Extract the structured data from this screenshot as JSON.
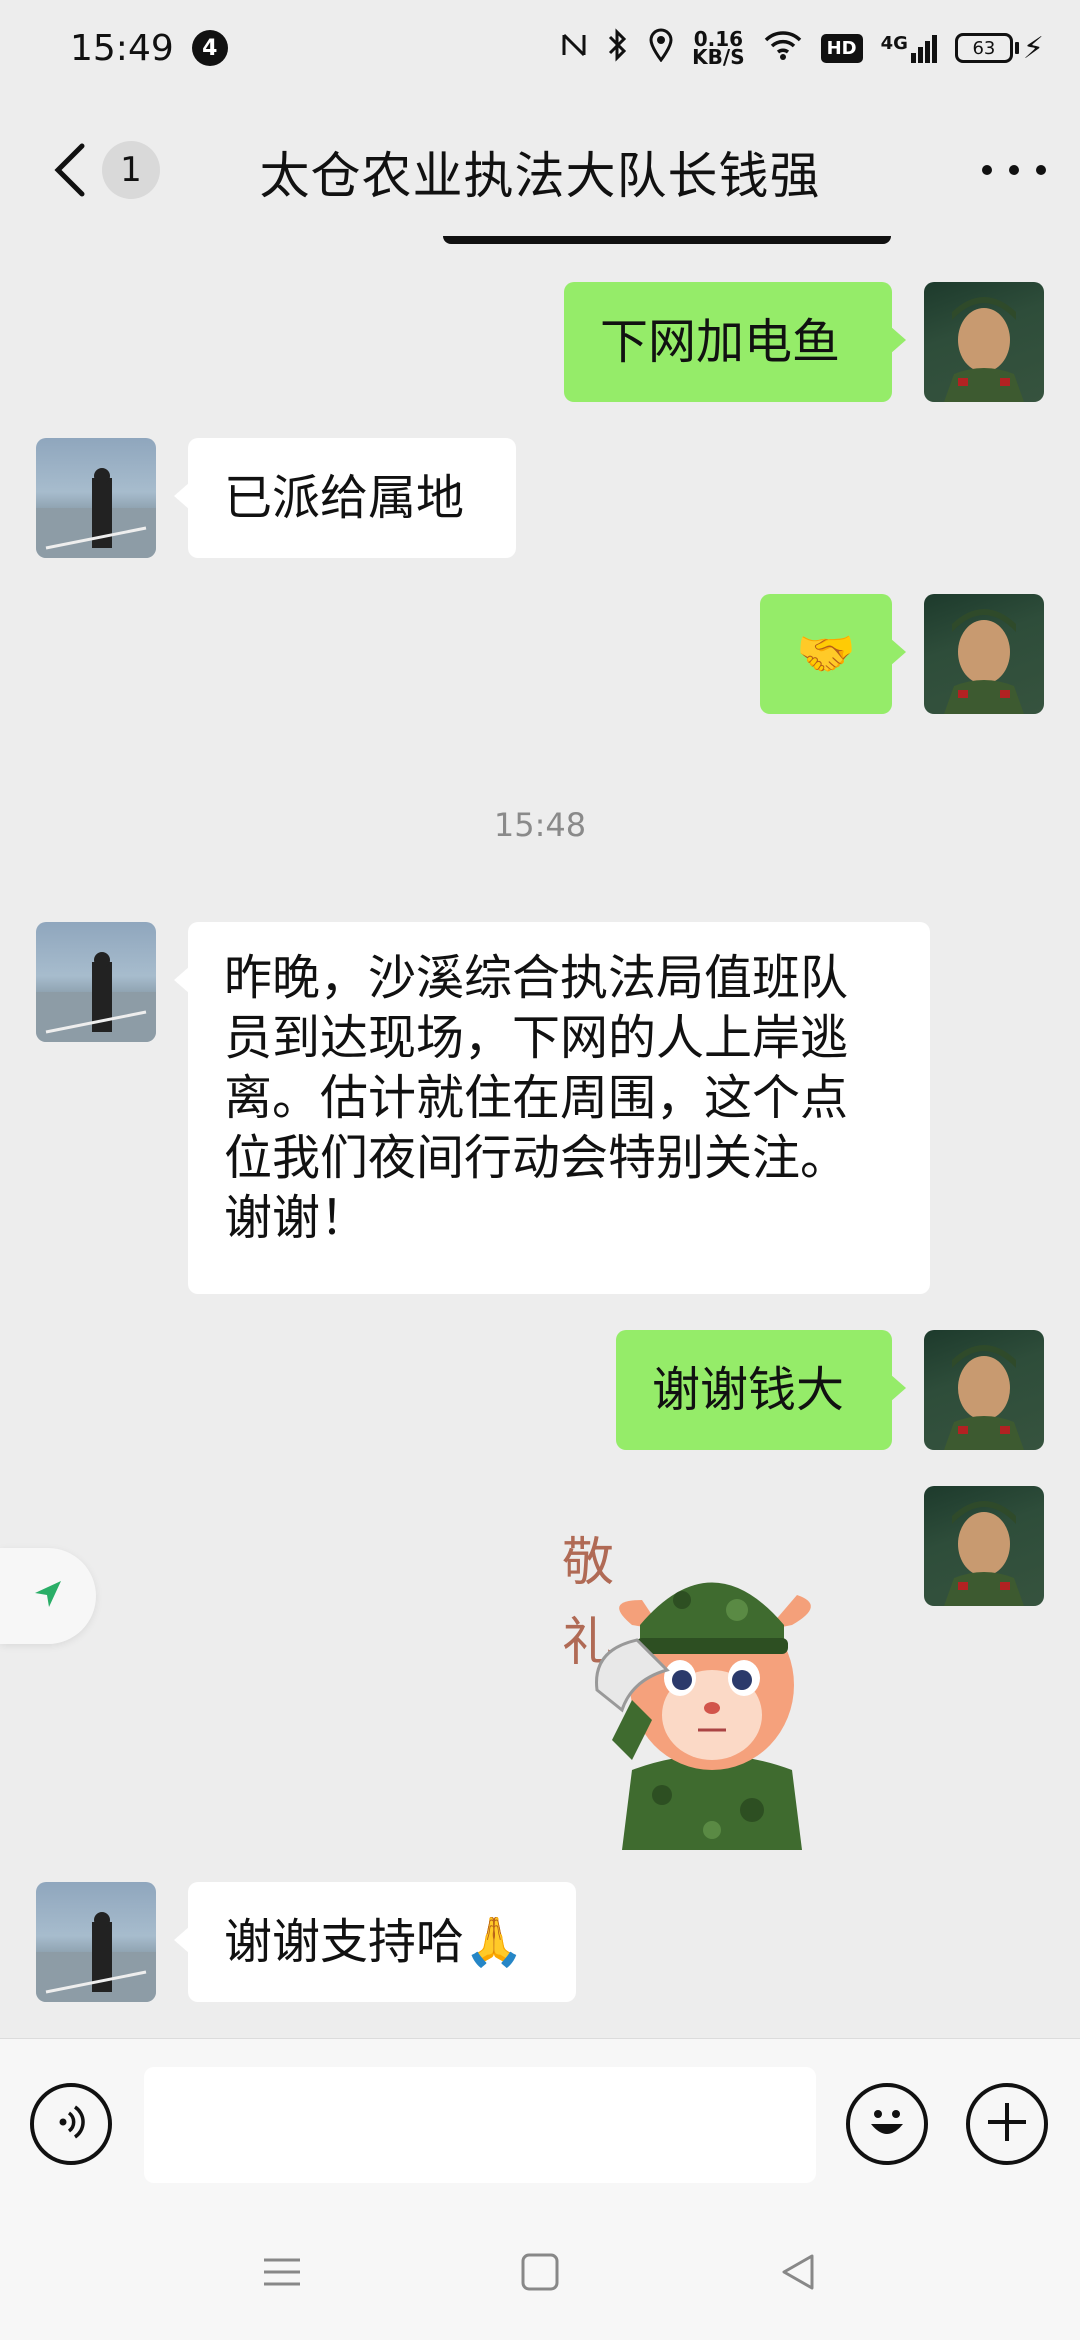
{
  "status_bar": {
    "time": "15:49",
    "notification_count": "4",
    "net_speed_value": "0.16",
    "net_speed_unit": "KB/S",
    "hd_label": "HD",
    "signal_label": "4G",
    "battery": "63"
  },
  "header": {
    "unread_count": "1",
    "title": "太仓农业执法大队长钱强"
  },
  "messages": [
    {
      "sender": "me",
      "text": "下网加电鱼"
    },
    {
      "sender": "other",
      "text": "已派给属地"
    },
    {
      "sender": "me",
      "text": "🤝"
    },
    {
      "sender": "system",
      "text": "15:48"
    },
    {
      "sender": "other",
      "lines": [
        "昨晚，沙溪综合执法局值班队",
        "员到达现场，下网的人上岸逃",
        "离。估计就住在周围，这个点",
        "位我们夜间行动会特别关注。",
        "谢谢！"
      ]
    },
    {
      "sender": "me",
      "text": "谢谢钱大"
    },
    {
      "sender": "me",
      "sticker_text": [
        "敬",
        "礼"
      ]
    },
    {
      "sender": "other",
      "text": "谢谢支持哈🙏"
    }
  ],
  "input": {
    "value": "",
    "placeholder": ""
  },
  "icons": {
    "voice": "voice-icon",
    "emoji": "emoji-icon",
    "plus": "plus-icon",
    "back": "chevron-left-icon",
    "more": "more-icon",
    "location": "location-arrow-icon"
  }
}
